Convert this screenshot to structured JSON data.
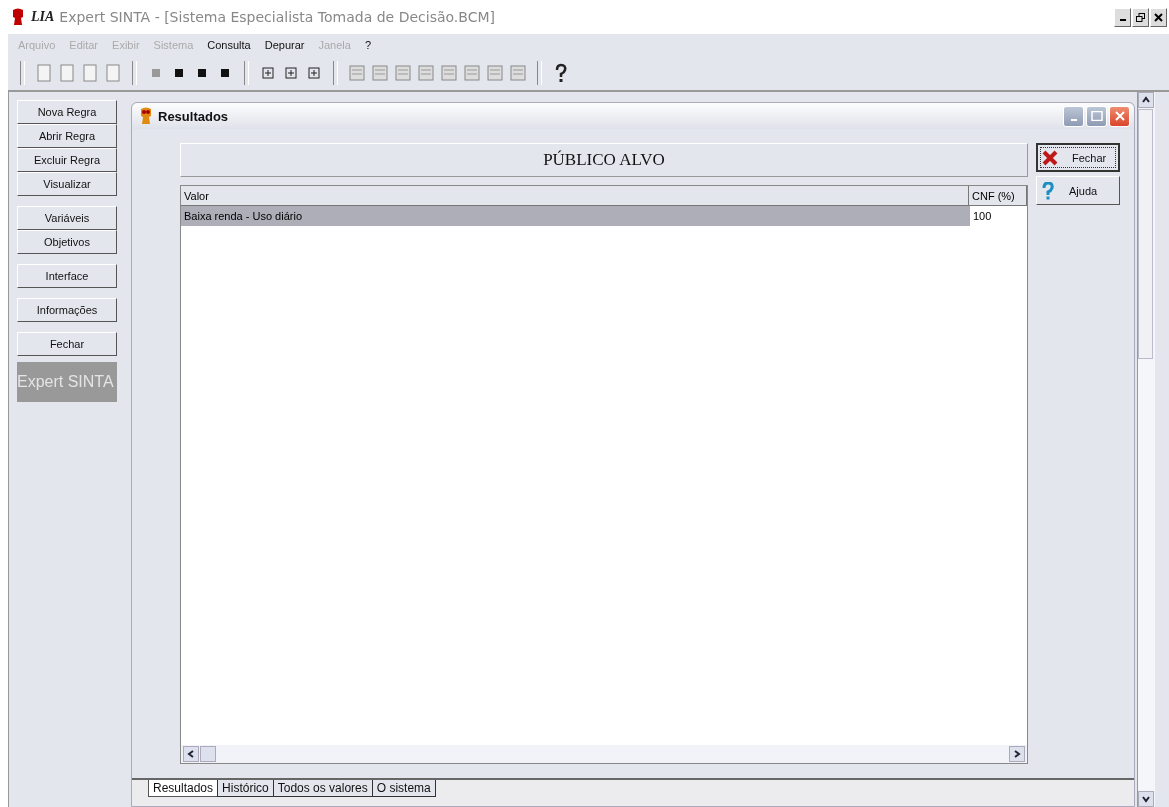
{
  "window": {
    "logo": "LIA",
    "title": "Expert SINTA - [Sistema Especialista Tomada de Decisão.BCM]"
  },
  "menu": [
    {
      "label": "Arquivo",
      "disabled": true
    },
    {
      "label": "Editar",
      "disabled": true
    },
    {
      "label": "Exibir",
      "disabled": true
    },
    {
      "label": "Sistema",
      "disabled": true
    },
    {
      "label": "Consulta",
      "disabled": false
    },
    {
      "label": "Depurar",
      "disabled": false
    },
    {
      "label": "Janela",
      "disabled": true
    },
    {
      "label": "?",
      "disabled": false
    }
  ],
  "sidebar": {
    "groups": [
      [
        "Nova Regra",
        "Abrir Regra",
        "Excluir Regra",
        "Visualizar"
      ],
      [
        "Variáveis",
        "Objetivos"
      ],
      [
        "Interface"
      ],
      [
        "Informações"
      ],
      [
        "Fechar"
      ]
    ],
    "brand": "Expert SINTA"
  },
  "child_window": {
    "title": "Resultados",
    "heading": "PÚBLICO ALVO",
    "table": {
      "columns": [
        "Valor",
        "CNF (%)"
      ],
      "rows": [
        {
          "cells": [
            "Baixa renda - Uso diário",
            "100"
          ],
          "selected": true
        }
      ]
    },
    "buttons": [
      {
        "label": "Fechar",
        "kind": "close"
      },
      {
        "label": "Ajuda",
        "kind": "help"
      }
    ],
    "tabs": [
      {
        "label": "Resultados",
        "selected": true
      },
      {
        "label": "Histórico",
        "selected": false
      },
      {
        "label": "Todos os valores",
        "selected": false
      },
      {
        "label": "O sistema",
        "selected": false
      }
    ]
  }
}
